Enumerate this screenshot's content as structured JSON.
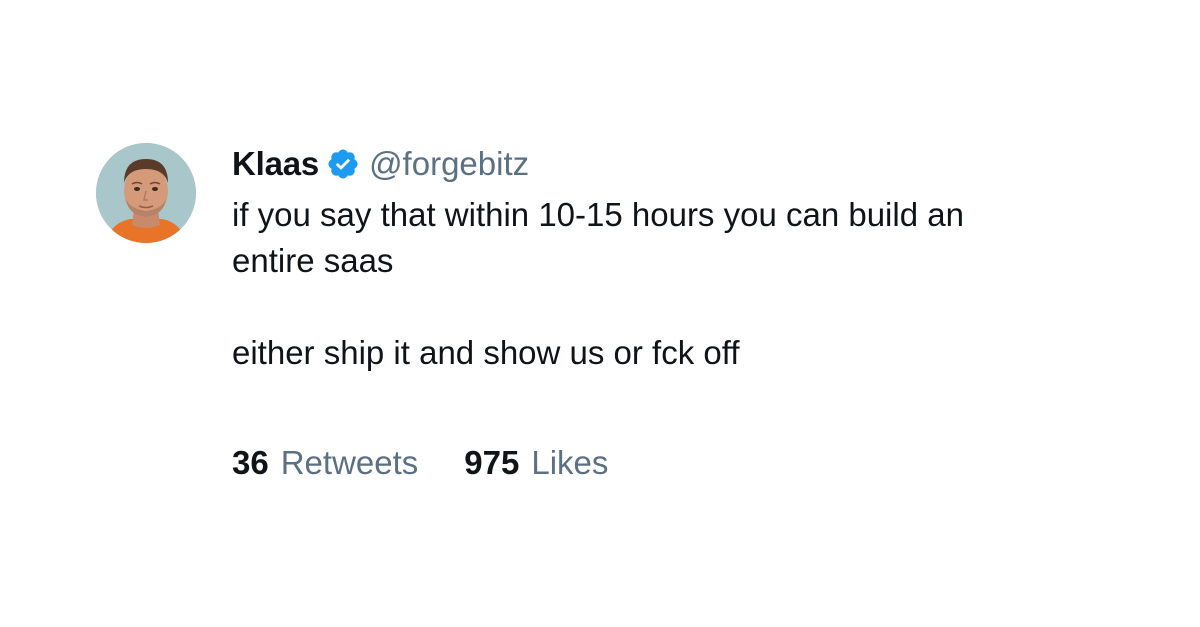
{
  "author": {
    "name": "Klaas",
    "handle": "@forgebitz",
    "verified": true,
    "avatar_icon": "profile-photo"
  },
  "tweet": {
    "line1": "if you say that within 10-15 hours you can build an",
    "line2": "entire saas",
    "line3": "either ship it and show us or fck off"
  },
  "stats": {
    "retweets_count": "36",
    "retweets_label": "Retweets",
    "likes_count": "975",
    "likes_label": "Likes"
  },
  "colors": {
    "text": "#0f1419",
    "secondary": "#5b7083",
    "verified": "#1d9bf0",
    "background": "#ffffff"
  }
}
